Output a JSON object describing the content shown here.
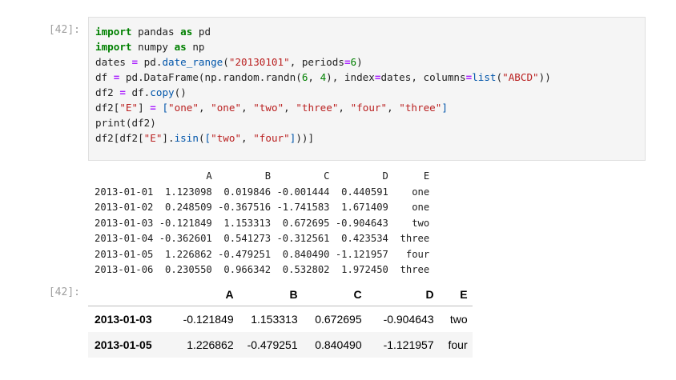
{
  "input_prompt": "[42]:",
  "output_prompt": "[42]:",
  "code_lines": [
    [
      {
        "t": "kw",
        "v": "import"
      },
      {
        "t": "",
        "v": " pandas "
      },
      {
        "t": "kw",
        "v": "as"
      },
      {
        "t": "",
        "v": " pd"
      }
    ],
    [
      {
        "t": "kw",
        "v": "import"
      },
      {
        "t": "",
        "v": " numpy "
      },
      {
        "t": "kw",
        "v": "as"
      },
      {
        "t": "",
        "v": " np"
      }
    ],
    [
      {
        "t": "",
        "v": "dates "
      },
      {
        "t": "op",
        "v": "="
      },
      {
        "t": "",
        "v": " pd."
      },
      {
        "t": "fn",
        "v": "date_range"
      },
      {
        "t": "",
        "v": "("
      },
      {
        "t": "str",
        "v": "\"20130101\""
      },
      {
        "t": "",
        "v": ", periods"
      },
      {
        "t": "op",
        "v": "="
      },
      {
        "t": "num",
        "v": "6"
      },
      {
        "t": "",
        "v": ")"
      }
    ],
    [
      {
        "t": "",
        "v": "df "
      },
      {
        "t": "op",
        "v": "="
      },
      {
        "t": "",
        "v": " pd.DataFrame(np.random.randn("
      },
      {
        "t": "num",
        "v": "6"
      },
      {
        "t": "",
        "v": ", "
      },
      {
        "t": "num",
        "v": "4"
      },
      {
        "t": "",
        "v": "), index"
      },
      {
        "t": "op",
        "v": "="
      },
      {
        "t": "",
        "v": "dates, columns"
      },
      {
        "t": "op",
        "v": "="
      },
      {
        "t": "fn",
        "v": "list"
      },
      {
        "t": "",
        "v": "("
      },
      {
        "t": "str",
        "v": "\"ABCD\""
      },
      {
        "t": "",
        "v": "))"
      }
    ],
    [
      {
        "t": "",
        "v": "df2 "
      },
      {
        "t": "op",
        "v": "="
      },
      {
        "t": "",
        "v": " df."
      },
      {
        "t": "fn",
        "v": "copy"
      },
      {
        "t": "",
        "v": "()"
      }
    ],
    [
      {
        "t": "",
        "v": "df2["
      },
      {
        "t": "str",
        "v": "\"E\""
      },
      {
        "t": "",
        "v": "] "
      },
      {
        "t": "op",
        "v": "="
      },
      {
        "t": "",
        "v": " "
      },
      {
        "t": "br",
        "v": "["
      },
      {
        "t": "str",
        "v": "\"one\""
      },
      {
        "t": "",
        "v": ", "
      },
      {
        "t": "str",
        "v": "\"one\""
      },
      {
        "t": "",
        "v": ", "
      },
      {
        "t": "str",
        "v": "\"two\""
      },
      {
        "t": "",
        "v": ", "
      },
      {
        "t": "str",
        "v": "\"three\""
      },
      {
        "t": "",
        "v": ", "
      },
      {
        "t": "str",
        "v": "\"four\""
      },
      {
        "t": "",
        "v": ", "
      },
      {
        "t": "str",
        "v": "\"three\""
      },
      {
        "t": "br",
        "v": "]"
      }
    ],
    [
      {
        "t": "",
        "v": "print(df2)"
      }
    ],
    [
      {
        "t": "",
        "v": "df2[df2["
      },
      {
        "t": "str",
        "v": "\"E\""
      },
      {
        "t": "",
        "v": "]."
      },
      {
        "t": "fn",
        "v": "isin"
      },
      {
        "t": "",
        "v": "("
      },
      {
        "t": "br",
        "v": "["
      },
      {
        "t": "str",
        "v": "\"two\""
      },
      {
        "t": "",
        "v": ", "
      },
      {
        "t": "str",
        "v": "\"four\""
      },
      {
        "t": "br",
        "v": "]"
      },
      {
        "t": "",
        "v": "))]"
      }
    ]
  ],
  "stdout_lines": [
    "                   A         B         C         D      E",
    "2013-01-01  1.123098  0.019846 -0.001444  0.440591    one",
    "2013-01-02  0.248509 -0.367516 -1.741583  1.671409    one",
    "2013-01-03 -0.121849  1.153313  0.672695 -0.904643    two",
    "2013-01-04 -0.362601  0.541273 -0.312561  0.423534  three",
    "2013-01-05  1.226862 -0.479251  0.840490 -1.121957   four",
    "2013-01-06  0.230550  0.966342  0.532802  1.972450  three"
  ],
  "result_table": {
    "columns": [
      "A",
      "B",
      "C",
      "D",
      "E"
    ],
    "rows": [
      {
        "index": "2013-01-03",
        "cells": [
          "-0.121849",
          "1.153313",
          "0.672695",
          "-0.904643",
          "two"
        ]
      },
      {
        "index": "2013-01-05",
        "cells": [
          "1.226862",
          "-0.479251",
          "0.840490",
          "-1.121957",
          "four"
        ]
      }
    ]
  }
}
